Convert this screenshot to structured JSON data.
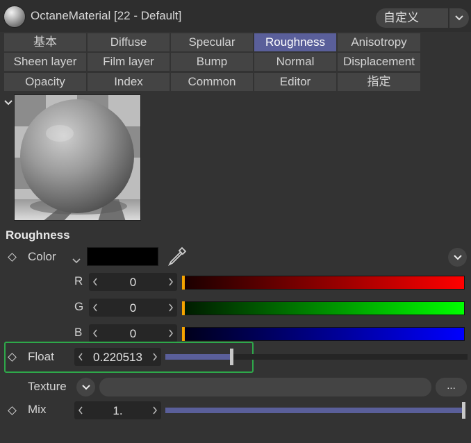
{
  "header": {
    "title": "OctaneMaterial [22 - Default]",
    "preset": "自定义"
  },
  "tabs": [
    {
      "label": "基本",
      "active": false
    },
    {
      "label": "Diffuse",
      "active": false
    },
    {
      "label": "Specular",
      "active": false
    },
    {
      "label": "Roughness",
      "active": true
    },
    {
      "label": "Anisotropy",
      "active": false
    },
    {
      "label": "Sheen layer",
      "active": false
    },
    {
      "label": "Film layer",
      "active": false
    },
    {
      "label": "Bump",
      "active": false
    },
    {
      "label": "Normal",
      "active": false
    },
    {
      "label": "Displacement",
      "active": false
    },
    {
      "label": "Opacity",
      "active": false
    },
    {
      "label": "Index",
      "active": false
    },
    {
      "label": "Common",
      "active": false
    },
    {
      "label": "Editor",
      "active": false
    },
    {
      "label": "指定",
      "active": false
    }
  ],
  "section": {
    "title": "Roughness"
  },
  "color": {
    "label": "Color",
    "swatch": "#000000",
    "channels": [
      {
        "label": "R",
        "value": "0",
        "gradient_end": "#ff0000"
      },
      {
        "label": "G",
        "value": "0",
        "gradient_end": "#00ff00"
      },
      {
        "label": "B",
        "value": "0",
        "gradient_end": "#0000ff"
      }
    ]
  },
  "float": {
    "label": "Float",
    "value": "0.220513",
    "fraction": 0.220513
  },
  "texture": {
    "label": "Texture",
    "browse_label": "..."
  },
  "mix": {
    "label": "Mix",
    "value": "1.",
    "fraction": 1.0
  },
  "colors": {
    "accent": "#5a5f9a",
    "highlight_box": "#2ea84a",
    "marker": "#f5a300"
  }
}
